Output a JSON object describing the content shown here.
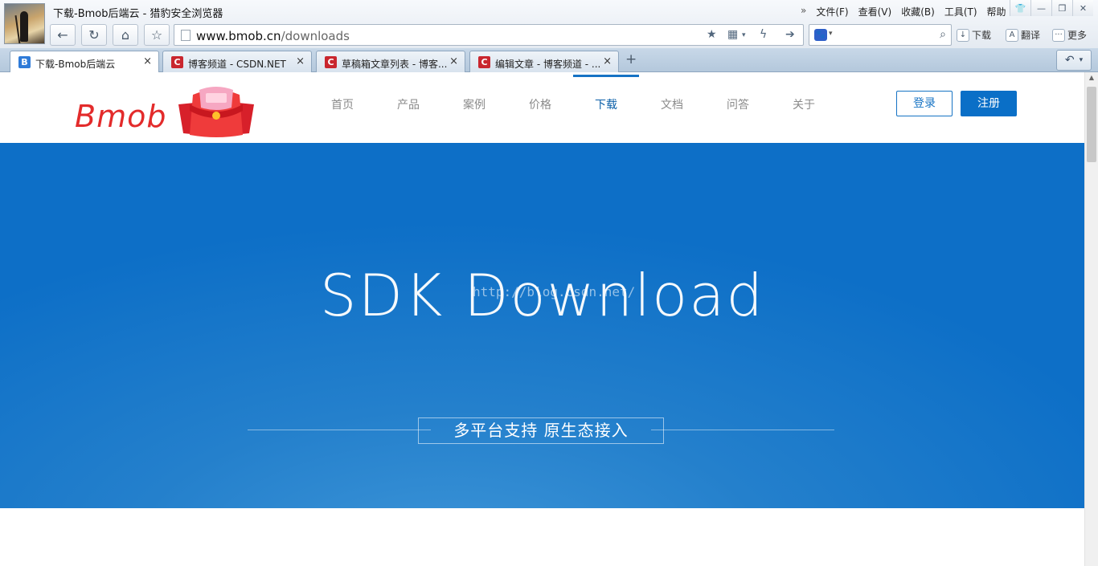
{
  "window": {
    "title": "下载-Bmob后端云 - 猎豹安全浏览器",
    "menus": [
      "文件(F)",
      "查看(V)",
      "收藏(B)",
      "工具(T)",
      "帮助"
    ]
  },
  "toolbar": {
    "url_host": "www.bmob.cn",
    "url_path": "/downloads",
    "download_label": "下载",
    "translate_label": "翻译",
    "more_label": "更多"
  },
  "tabs": [
    {
      "label": "下载-Bmob后端云",
      "favicon": "B",
      "active": true
    },
    {
      "label": "博客频道 - CSDN.NET",
      "favicon": "C",
      "active": false
    },
    {
      "label": "草稿箱文章列表 - 博客...",
      "favicon": "C",
      "active": false
    },
    {
      "label": "编辑文章 - 博客频道 - ...",
      "favicon": "C",
      "active": false
    }
  ],
  "site": {
    "logo_text": "Bmob",
    "nav": [
      {
        "label": "首页",
        "active": false
      },
      {
        "label": "产品",
        "active": false
      },
      {
        "label": "案例",
        "active": false
      },
      {
        "label": "价格",
        "active": false
      },
      {
        "label": "下载",
        "active": true
      },
      {
        "label": "文档",
        "active": false
      },
      {
        "label": "问答",
        "active": false
      },
      {
        "label": "关于",
        "active": false
      }
    ],
    "login_label": "登录",
    "register_label": "注册"
  },
  "banner": {
    "title": "SDK Download",
    "watermark": "http://blog.csdn.net/",
    "tagline": "多平台支持  原生态接入"
  },
  "colors": {
    "brand_red": "#e32b2b",
    "accent_blue": "#0a6fc7",
    "banner_blue": "#1f7dcb"
  }
}
